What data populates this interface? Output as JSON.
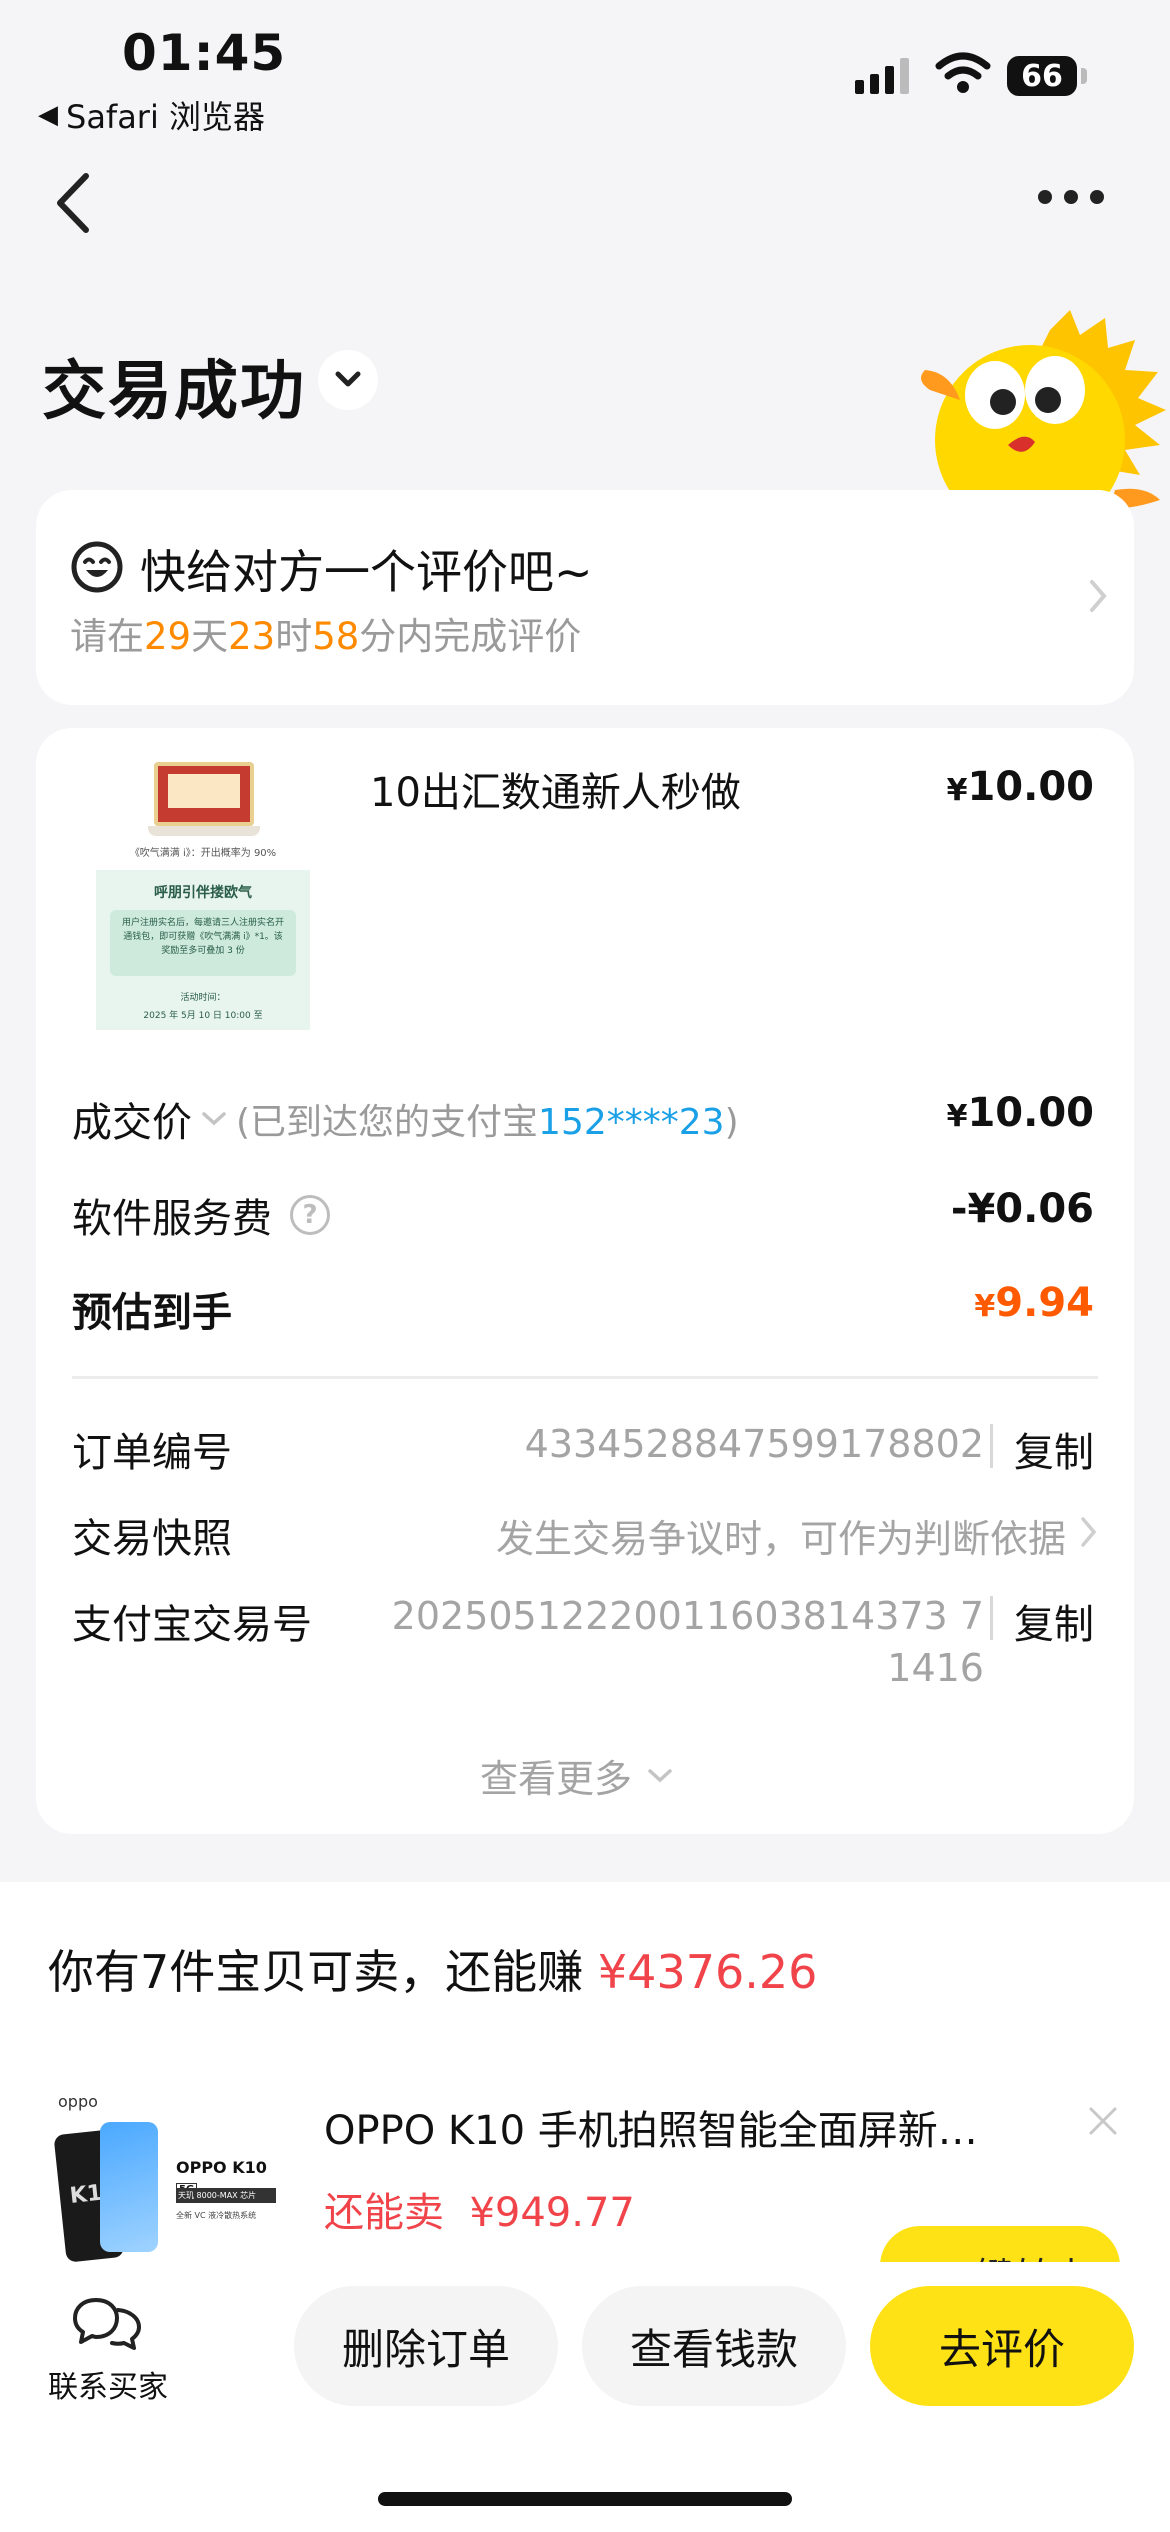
{
  "status_bar": {
    "time": "01:45",
    "back_app": "Safari 浏览器",
    "battery": "66"
  },
  "header": {
    "title": "交易成功"
  },
  "review": {
    "title": "快给对方一个评价吧~",
    "sub_prefix": "请在",
    "days": "29",
    "days_unit": "天",
    "hours": "23",
    "hours_unit": "时",
    "minutes": "58",
    "sub_suffix": "分内完成评价"
  },
  "order": {
    "product_name": "10出汇数通新人秒做",
    "product_price_symbol": "¥",
    "product_price": "10.00",
    "deal_price_label": "成交价",
    "deal_price_note_prefix": "(已到达您的支付宝",
    "deal_price_account": "152****23",
    "deal_price_note_suffix": ")",
    "deal_price_value": "10.00",
    "service_fee_label": "软件服务费",
    "service_fee_value": "-¥0.06",
    "estimated_label": "预估到手",
    "estimated_value": "9.94",
    "order_no_label": "订单编号",
    "order_no": "4334528847599178802",
    "snapshot_label": "交易快照",
    "snapshot_value": "发生交易争议时，可作为判断依据",
    "alipay_no_label": "支付宝交易号",
    "alipay_no_line1": "20250512220011603814373 7",
    "alipay_no_line2": "1416",
    "copy_label": "复制",
    "more_label": "查看更多"
  },
  "thumbnail": {
    "caption_line": "《吹气满满 i》：开出概率为 90%",
    "card_title": "呼朋引伴搂欧气",
    "card_text": "用户注册实名后，每邀请三人注册实名开通钱包，即可获赠《吹气满满 i》*1。该奖励至多可叠加 3 份",
    "card_time_label": "活动时间：",
    "card_time": "2025 年 5月 10 日 10:00 至"
  },
  "sell": {
    "prefix": "你有",
    "count": "7",
    "middle": "件宝贝可卖，还能赚",
    "amount": "¥4376.26"
  },
  "recommend": {
    "title": "OPPO K10 手机拍照智能全面屏新…",
    "price_label": "还能卖",
    "price": "¥949.77",
    "img_brand": "oppo",
    "img_model": "OPPO K10",
    "img_badge": "5G",
    "img_line1": "天玑 8000-MAX 芯片",
    "img_line2": "全新 VC 液冷散热系统",
    "img_phone_text": "K10",
    "peek_button": "一键转卖"
  },
  "toolbar": {
    "contact_label": "联系买家",
    "delete_label": "删除订单",
    "view_money_label": "查看钱款",
    "review_label": "去评价"
  },
  "colors": {
    "accent_yellow": "#ffe215",
    "orange": "#ff5a00",
    "red": "#f0444a",
    "blue": "#1aa0e6",
    "countdown": "#ff8a00"
  }
}
